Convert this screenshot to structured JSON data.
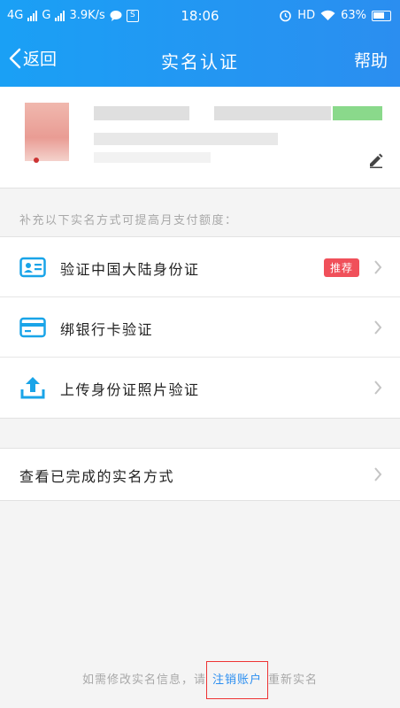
{
  "status_bar": {
    "net1": "4G",
    "net2": "G",
    "speed": "3.9K/s",
    "time": "18:06",
    "hd": "HD",
    "battery": "63%"
  },
  "nav": {
    "back_label": "返回",
    "title": "实名认证",
    "help_label": "帮助"
  },
  "hint": "补充以下实名方式可提高月支付额度：",
  "verify_items": [
    {
      "label": "验证中国大陆身份证",
      "badge": "推荐",
      "icon": "id-card-icon"
    },
    {
      "label": "绑银行卡验证",
      "icon": "bank-card-icon"
    },
    {
      "label": "上传身份证照片验证",
      "icon": "upload-icon"
    }
  ],
  "view_completed": "查看已完成的实名方式",
  "footer": {
    "prefix": "如需修改实名信息，请",
    "link": "注销账户",
    "suffix": "重新实名"
  },
  "colors": {
    "brand": "#1aa0f5",
    "badge": "#f0505a",
    "link": "#2b8ef0"
  }
}
